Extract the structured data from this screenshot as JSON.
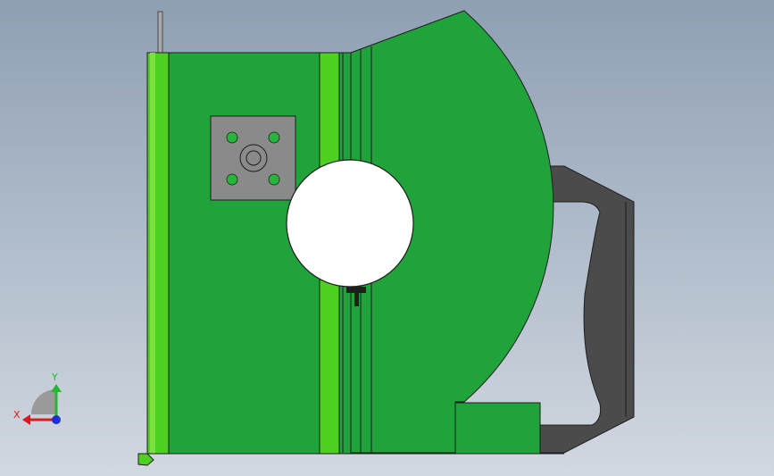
{
  "triad": {
    "x_label": "X",
    "y_label": "Y"
  },
  "colors": {
    "background_top": "#8f9fb3",
    "background_bottom": "#d2d8e0",
    "body_green": "#1fa33a",
    "light_green": "#4dd01f",
    "plate_gray": "#8a8a8a",
    "handle_gray": "#4b4b4b",
    "hole_green": "#27b53c",
    "outline": "#1e1e1e",
    "axis_x": "#e0181e",
    "axis_y": "#22b832",
    "axis_z": "#2030d8"
  },
  "icons": {
    "triad": "coordinate-triad-icon",
    "bore": "circular-bore",
    "handle": "handle-grip"
  }
}
